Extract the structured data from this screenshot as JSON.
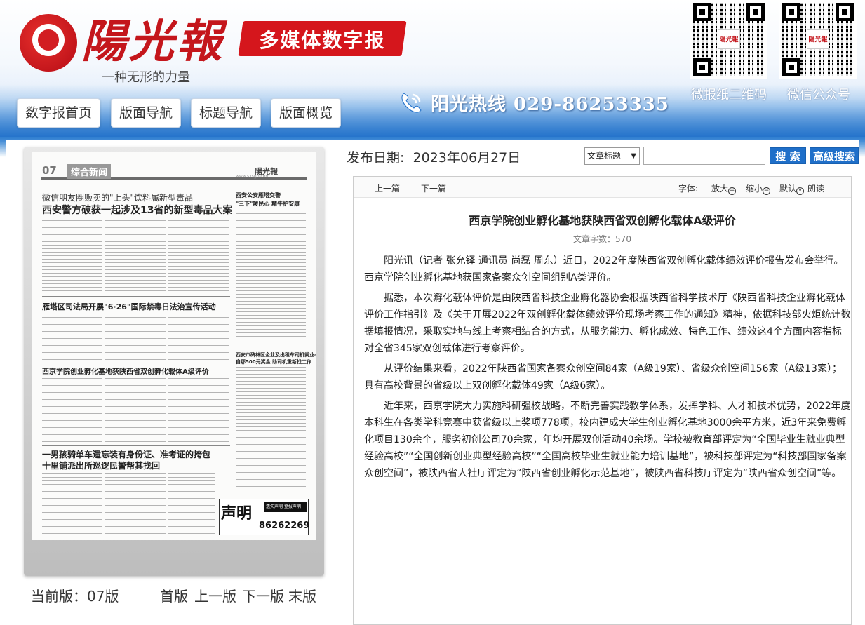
{
  "header": {
    "logo_text": "陽光報",
    "slogan": "一种无形的力量",
    "banner": "多媒体数字报",
    "hotline": "阳光热线 029-86253335",
    "qr_codes": [
      {
        "label": "微报纸二维码"
      },
      {
        "label": "微信公众号"
      }
    ],
    "qr_logo": "陽光報"
  },
  "nav": {
    "items": [
      {
        "label": "数字报首页"
      },
      {
        "label": "版面导航"
      },
      {
        "label": "标题导航"
      },
      {
        "label": "版面概览"
      }
    ]
  },
  "page_thumb": {
    "page_no": "07",
    "section": "综合新闻",
    "masthead": "陽光報",
    "url": "www.sxsgb.com",
    "headlines": [
      "微信朋友圈贩卖的\"上头\"饮料属新型毒品",
      "西安警方破获一起涉及13省的新型毒品大案",
      "西安公安雁塔交警",
      "\"三下\"暖民心 精牛护安康",
      "雁塔区司法局开展\"6·26\"国际禁毒日法治宣传活动",
      "西京学院创业孵化基地获陕西省双创孵化载体A级评价",
      "西安市碑林区企业及出租车司机就业心",
      "自那500元奖金 助司机重新找工作",
      "一男孩骑单车遗忘装有身份证、准考证的挎包",
      "十里铺派出所巡逻民警帮其找回"
    ],
    "ad_title": "声明",
    "ad_banner": "遗失声明 登报声明",
    "ad_phone": "86262269"
  },
  "pager": {
    "current_label": "当前版：07版",
    "first": "首版",
    "prev": "上一版",
    "next": "下一版",
    "last": "末版"
  },
  "pub": {
    "label": "发布日期:",
    "date": "2023年06月27日"
  },
  "search": {
    "select_value": "文章标题",
    "input_value": "",
    "search_button": "搜 索",
    "advanced_button": "高级搜索"
  },
  "toolbar": {
    "prev_article": "上一篇",
    "next_article": "下一篇",
    "font_label": "字体:",
    "zoom_in": "放大",
    "zoom_out": "缩小",
    "default": "默认",
    "read_aloud": "朗读"
  },
  "article": {
    "title": "西京学院创业孵化基地获陕西省双创孵化载体A级评价",
    "word_count": "文章字数：570",
    "paragraphs": [
      "阳光讯（记者 张允铎 通讯员 尚磊 周东）近日，2022年度陕西省双创孵化载体绩效评价报告发布会举行。西京学院创业孵化基地获国家备案众创空间组别A类评价。",
      "据悉，本次孵化载体评价是由陕西省科技企业孵化器协会根据陕西省科学技术厅《陕西省科技企业孵化载体评价工作指引》及《关于开展2022年双创孵化载体绩效评价现场考察工作的通知》精神，依据科技部火炬统计数据填报情况，采取实地与线上考察相结合的方式，从服务能力、孵化成效、特色工作、绩效这4个方面内容指标对全省345家双创载体进行考察评价。",
      "从评价结果来看，2022年陕西省国家备案众创空间84家（A级19家）、省级众创空间156家（A级13家）；具有高校背景的省级以上双创孵化载体49家（A级6家）。",
      "近年来，西京学院大力实施科研强校战略，不断完善实践教学体系，发挥学科、人才和技术优势，2022年度本科生在各类学科竞赛中获省级以上奖项778项，校内建成大学生创业孵化基地3000余平方米，近3年来免费孵化项目130余个，服务初创公司70余家，年均开展双创活动40余场。学校被教育部评定为“全国毕业生就业典型经验高校”“全国创新创业典型经验高校”“全国高校毕业生就业能力培训基地”，被科技部评定为“科技部国家备案众创空间”，被陕西省人社厅评定为“陕西省创业孵化示范基地”，被陕西省科技厅评定为“陕西省众创空间”等。"
    ]
  },
  "colors": {
    "brand_red": "#c4161c",
    "header_blue": "#1f6fc9"
  }
}
